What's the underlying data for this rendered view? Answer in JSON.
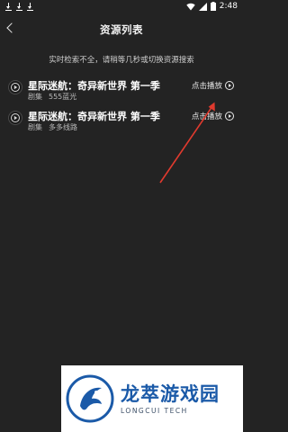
{
  "status_bar": {
    "time": "2:48"
  },
  "header": {
    "title": "资源列表"
  },
  "notice": "实时检索不全，请稍等几秒或切换资源搜索",
  "resources": [
    {
      "title": "星际迷航：奇异新世界 第一季",
      "type": "剧集",
      "source": "555蓝光",
      "play_label": "点击播放"
    },
    {
      "title": "星际迷航：奇异新世界 第一季",
      "type": "剧集",
      "source": "多多线路",
      "play_label": "点击播放"
    }
  ],
  "watermark": {
    "main": "龙萃游戏园",
    "sub": "LONGCUI TECH"
  },
  "colors": {
    "background": "#232323",
    "arrow": "#e03a2e",
    "watermark_blue": "#1b5aa8"
  }
}
